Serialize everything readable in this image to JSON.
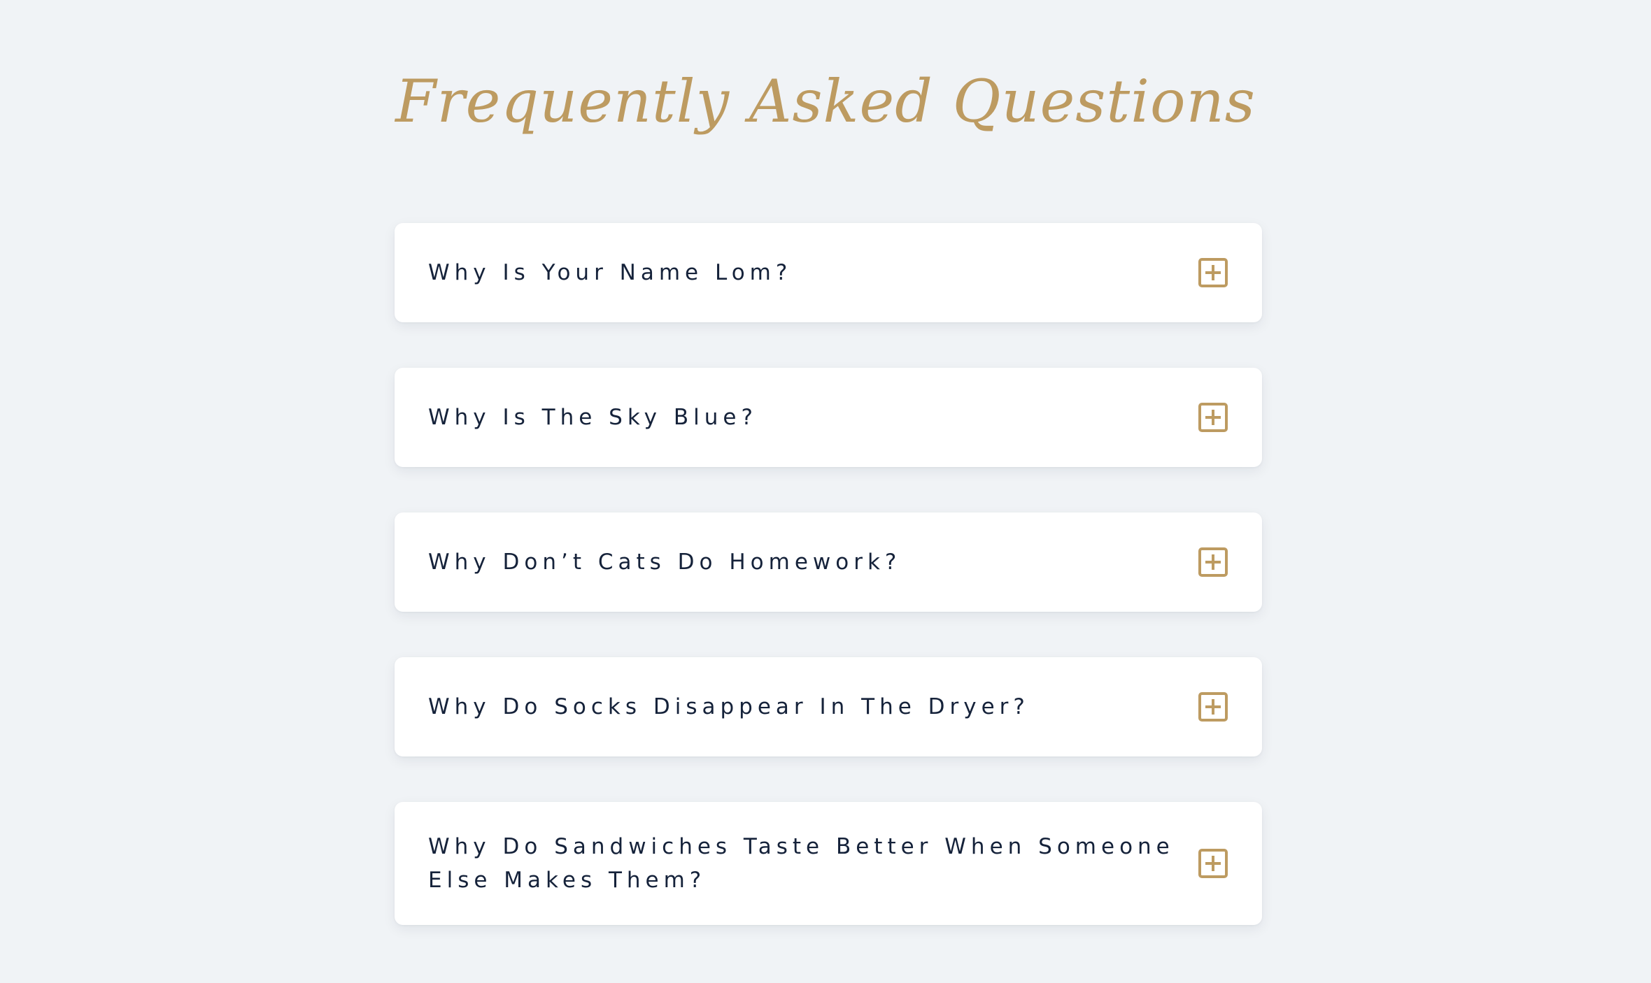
{
  "page": {
    "title": "Frequently Asked Questions"
  },
  "faq": {
    "items": [
      {
        "question": "Why Is Your Name Lom?",
        "icon": "plus-square-icon"
      },
      {
        "question": "Why Is The Sky Blue?",
        "icon": "plus-square-icon"
      },
      {
        "question": "Why Don’t Cats Do Homework?",
        "icon": "plus-square-icon"
      },
      {
        "question": "Why Do Socks Disappear In The Dryer?",
        "icon": "plus-square-icon"
      },
      {
        "question": "Why Do Sandwiches Taste Better When Someone Else Makes Them?",
        "icon": "plus-square-icon"
      }
    ]
  },
  "colors": {
    "background": "#f0f3f6",
    "accent": "#bd9b61",
    "text": "#15223a",
    "card": "#ffffff"
  }
}
